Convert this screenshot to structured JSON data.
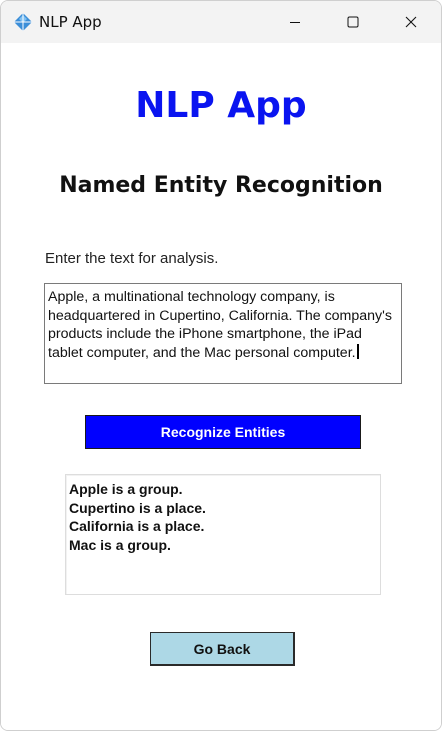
{
  "window": {
    "title": "NLP App",
    "icon": "blue-diamond-app-icon",
    "controls": {
      "minimize": "minimize-icon",
      "maximize": "maximize-icon",
      "close": "close-icon"
    }
  },
  "main": {
    "app_title": "NLP App",
    "section_title": "Named Entity Recognition",
    "prompt": "Enter the text for analysis.",
    "input_text": "Apple, a multinational technology company, is headquartered in Cupertino, California. The company's products include the iPhone smartphone, the iPad tablet computer, and the Mac personal computer.",
    "recognize_button": "Recognize Entities",
    "results": [
      "Apple is a group.",
      "Cupertino is a place.",
      "California is a place.",
      "Mac is a group."
    ],
    "go_back_button": "Go Back"
  },
  "colors": {
    "app_title": "#0a14f0",
    "recognize_button_bg": "#0000ff",
    "go_back_button_bg": "#add8e6",
    "titlebar_bg": "#f3f3f3"
  }
}
